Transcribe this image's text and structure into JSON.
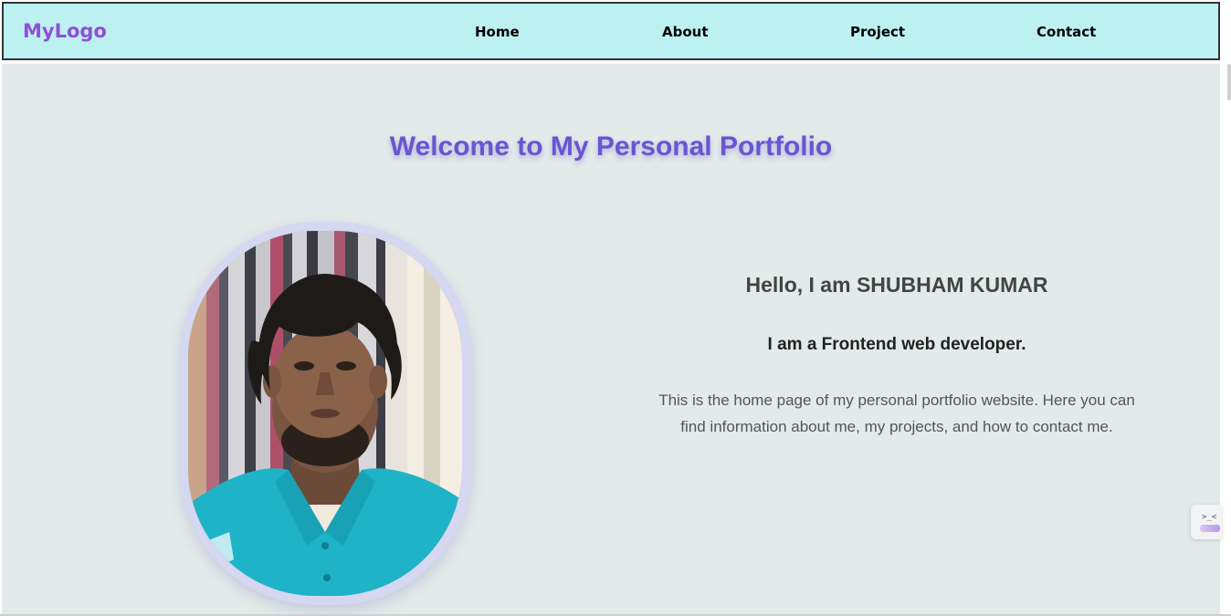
{
  "navbar": {
    "logo": "MyLogo",
    "items": [
      {
        "label": "Home"
      },
      {
        "label": "About"
      },
      {
        "label": "Project"
      },
      {
        "label": "Contact"
      }
    ]
  },
  "hero": {
    "heading": "Welcome to My Personal Portfolio",
    "greeting": "Hello, I am SHUBHAM KUMAR",
    "role": "I am a Frontend web developer.",
    "description": "This is the home page of my personal portfolio website. Here you can find information about me, my projects, and how to contact me."
  },
  "widget": {
    "icon": "terminal-icon",
    "glyph": ">_<"
  },
  "colors": {
    "navbar_bg": "#bdf0f1",
    "logo": "#8e4fd6",
    "heading": "#6a55d0",
    "main_bg": "#e2eaea",
    "frame": "#d5d8f0",
    "shirt": "#1fb3c8"
  }
}
